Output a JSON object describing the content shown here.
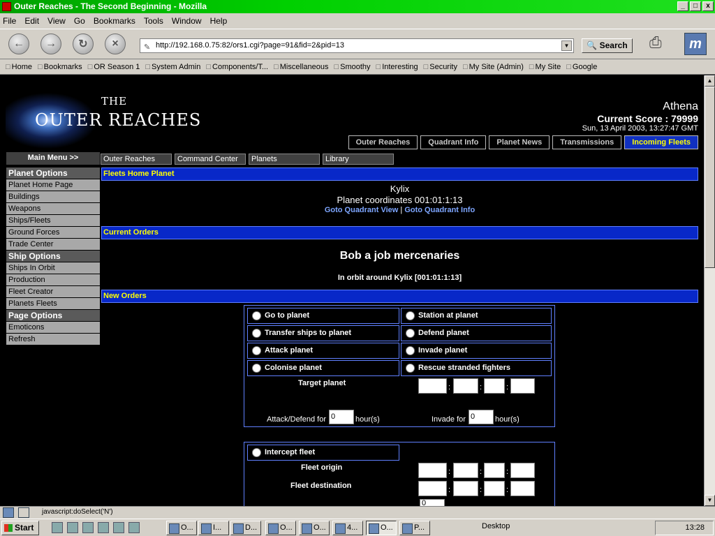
{
  "window": {
    "title": "Outer Reaches - The Second Beginning - Mozilla",
    "min": "_",
    "max": "□",
    "close": "x"
  },
  "menu": [
    "File",
    "Edit",
    "View",
    "Go",
    "Bookmarks",
    "Tools",
    "Window",
    "Help"
  ],
  "nav": {
    "url": "http://192.168.0.75:82/ors1.cgi?page=91&fid=2&pid=13",
    "search": "Search"
  },
  "bookmarks": [
    "Home",
    "Bookmarks",
    "OR Season 1",
    "System Admin",
    "Components/T...",
    "Miscellaneous",
    "Smoothy",
    "Interesting",
    "Security",
    "My Site (Admin)",
    "My Site",
    "Google"
  ],
  "logo": {
    "the": "THE",
    "name": "OUTER REACHES"
  },
  "user": {
    "name": "Athena",
    "score": "Current Score : 79999",
    "date": "Sun, 13 April 2003, 13:27:47 GMT"
  },
  "top_tabs": [
    "Outer Reaches",
    "Quadrant Info",
    "Planet News",
    "Transmissions",
    "Incoming Fleets"
  ],
  "main_menu": "Main Menu >>",
  "sub_nav": [
    "Outer Reaches",
    "Command Center",
    "Planets",
    "Library"
  ],
  "sidebar": [
    {
      "label": "Planet Options",
      "head": true
    },
    {
      "label": "Planet Home Page"
    },
    {
      "label": "Buildings"
    },
    {
      "label": "Weapons"
    },
    {
      "label": "Ships/Fleets"
    },
    {
      "label": "Ground Forces"
    },
    {
      "label": "Trade Center"
    },
    {
      "label": "Ship Options",
      "head": true
    },
    {
      "label": "Ships In Orbit"
    },
    {
      "label": "Production"
    },
    {
      "label": "Fleet Creator"
    },
    {
      "label": "Planets Fleets"
    },
    {
      "label": "Page Options",
      "head": true
    },
    {
      "label": "Emoticons"
    },
    {
      "label": "Refresh"
    }
  ],
  "home": {
    "heading": "Fleets Home Planet",
    "planet": "Kylix",
    "coords": "Planet coordinates 001:01:1:13",
    "link1": "Goto Quadrant View",
    "sep": "|",
    "link2": "Goto Quadrant Info"
  },
  "current": {
    "heading": "Current Orders",
    "fleet": "Bob a job mercenaries",
    "orbit": "In orbit around Kylix [001:01:1:13]"
  },
  "neworders": {
    "heading": "New Orders",
    "options": [
      "Go to planet",
      "Station at planet",
      "Transfer ships to planet",
      "Defend planet",
      "Attack planet",
      "Invade planet",
      "Colonise planet",
      "Rescue stranded fighters"
    ],
    "target": "Target planet",
    "attack_for": "Attack/Defend for",
    "attack_val": "0",
    "hours": "hour(s)",
    "invade_for": "Invade for",
    "invade_val": "0",
    "intercept": "Intercept fleet",
    "origin": "Fleet origin",
    "destination": "Fleet destination",
    "extra_val": "0"
  },
  "status": {
    "text": "javascript:doSelect('N')"
  },
  "taskbar": {
    "start": "Start",
    "items": [
      "O...",
      "I...",
      "D...",
      "O...",
      "O...",
      "4...",
      "O...",
      "P..."
    ],
    "desktop": "Desktop",
    "clock": "13:28"
  }
}
